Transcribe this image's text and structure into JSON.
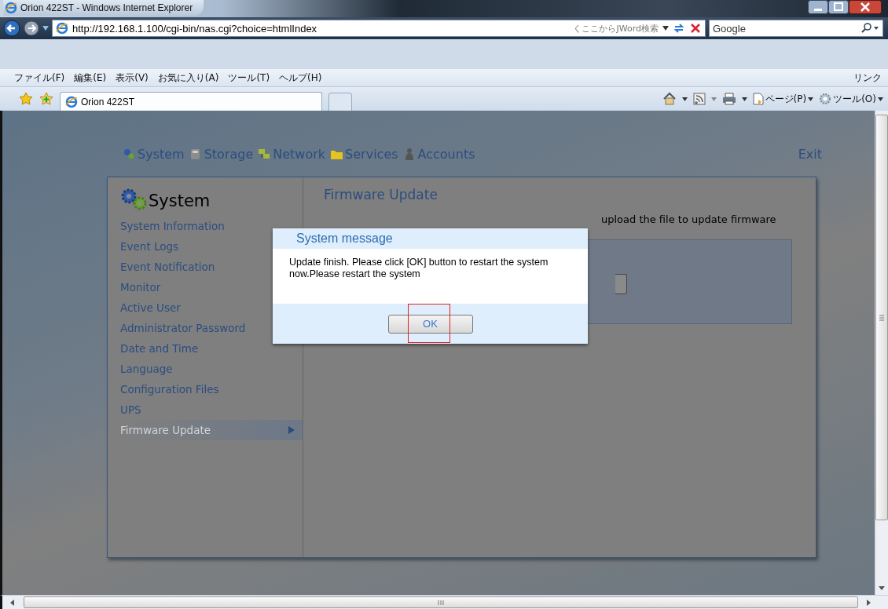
{
  "window": {
    "title": "Orion 422ST - Windows Internet Explorer"
  },
  "address_bar": {
    "url": "http://192.168.1.100/cgi-bin/nas.cgi?choice=htmlIndex",
    "search_provider": "くここからJWord検索",
    "search_value": "Google"
  },
  "menu": [
    "ファイル(F)",
    "編集(E)",
    "表示(V)",
    "お気に入り(A)",
    "ツール(T)",
    "ヘルプ(H)"
  ],
  "links_label": "リンク",
  "tab": {
    "title": "Orion 422ST"
  },
  "command_bar": [
    "ページ(P)",
    "ツール(O)"
  ],
  "nav": [
    {
      "kind": "gears",
      "label": "System"
    },
    {
      "kind": "disk",
      "label": "Storage"
    },
    {
      "kind": "network",
      "label": "Network"
    },
    {
      "kind": "folder",
      "label": "Services"
    },
    {
      "kind": "person",
      "label": "Accounts"
    }
  ],
  "exit": "Exit",
  "sidebar": {
    "title": "System",
    "items": [
      {
        "label": "System Information",
        "selected": false
      },
      {
        "label": "Event Logs",
        "selected": false
      },
      {
        "label": "Event Notification",
        "selected": false
      },
      {
        "label": "Monitor",
        "selected": false
      },
      {
        "label": "Active User",
        "selected": false
      },
      {
        "label": "Administrator Password",
        "selected": false
      },
      {
        "label": "Date and Time",
        "selected": false
      },
      {
        "label": "Language",
        "selected": false
      },
      {
        "label": "Configuration Files",
        "selected": false
      },
      {
        "label": "UPS",
        "selected": false
      },
      {
        "label": "Firmware Update",
        "selected": true
      }
    ]
  },
  "main": {
    "heading": "Firmware Update",
    "note": "upload the file to update firmware"
  },
  "dialog": {
    "title": "System message",
    "message": "Update finish. Please click [OK] button to restart the system now.Please restart the system",
    "button": "OK",
    "button_highlighted": true
  }
}
